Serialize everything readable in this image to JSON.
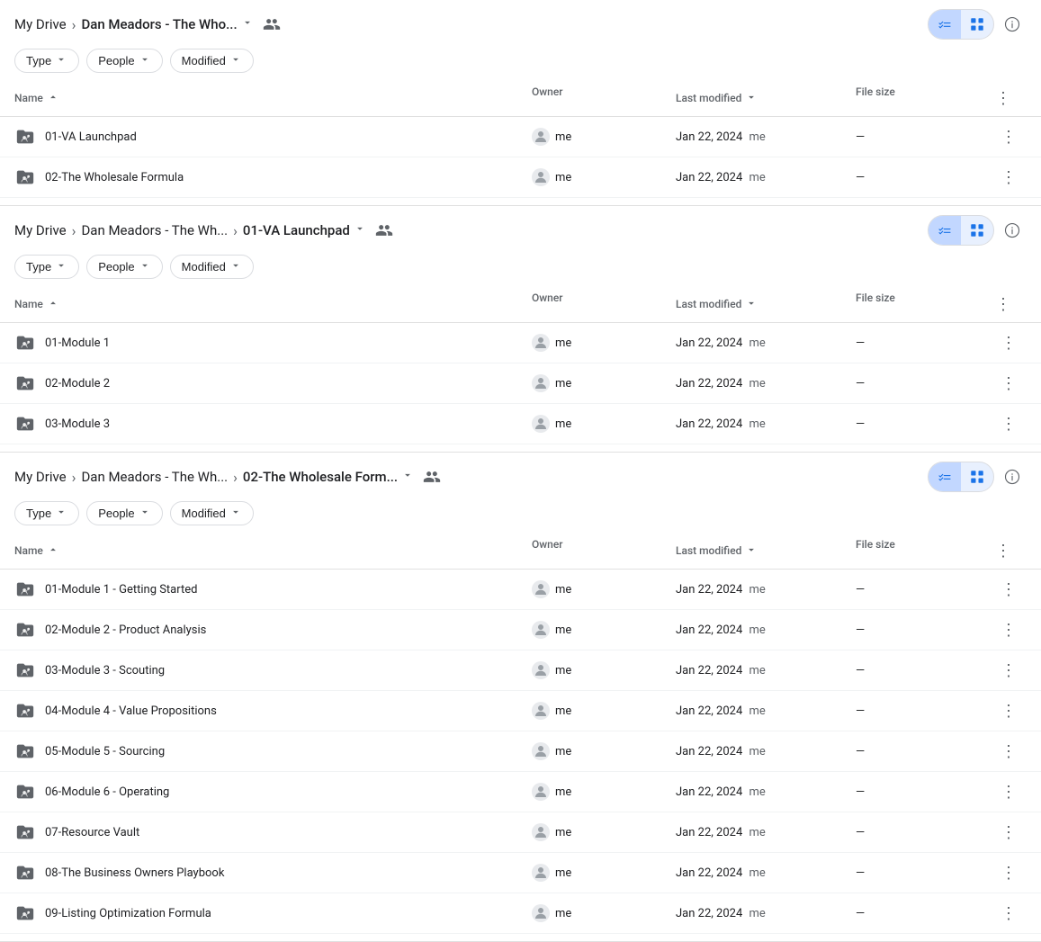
{
  "sections": [
    {
      "id": "section1",
      "breadcrumb": {
        "parts": [
          "My Drive",
          "Dan Meadors - The Who..."
        ],
        "current": null,
        "showCurrent": false
      },
      "filters": [
        "Type",
        "People",
        "Modified"
      ],
      "columns": [
        "Name",
        "Owner",
        "Last modified",
        "File size"
      ],
      "rows": [
        {
          "name": "01-VA Launchpad",
          "owner": "me",
          "modified": "Jan 22, 2024",
          "modifiedBy": "me",
          "fileSize": "—"
        },
        {
          "name": "02-The Wholesale Formula",
          "owner": "me",
          "modified": "Jan 22, 2024",
          "modifiedBy": "me",
          "fileSize": "—"
        }
      ]
    },
    {
      "id": "section2",
      "breadcrumb": {
        "parts": [
          "My Drive",
          "Dan Meadors - The Wh...",
          "01-VA Launchpad"
        ],
        "current": null,
        "showCurrent": false
      },
      "filters": [
        "Type",
        "People",
        "Modified"
      ],
      "columns": [
        "Name",
        "Owner",
        "Last modified",
        "File size"
      ],
      "rows": [
        {
          "name": "01-Module 1",
          "owner": "me",
          "modified": "Jan 22, 2024",
          "modifiedBy": "me",
          "fileSize": "—"
        },
        {
          "name": "02-Module 2",
          "owner": "me",
          "modified": "Jan 22, 2024",
          "modifiedBy": "me",
          "fileSize": "—"
        },
        {
          "name": "03-Module 3",
          "owner": "me",
          "modified": "Jan 22, 2024",
          "modifiedBy": "me",
          "fileSize": "—"
        }
      ]
    },
    {
      "id": "section3",
      "breadcrumb": {
        "parts": [
          "My Drive",
          "Dan Meadors - The Wh...",
          "02-The Wholesale Form..."
        ],
        "current": null,
        "showCurrent": false
      },
      "filters": [
        "Type",
        "People",
        "Modified"
      ],
      "columns": [
        "Name",
        "Owner",
        "Last modified",
        "File size"
      ],
      "rows": [
        {
          "name": "01-Module 1 - Getting Started",
          "owner": "me",
          "modified": "Jan 22, 2024",
          "modifiedBy": "me",
          "fileSize": "—"
        },
        {
          "name": "02-Module 2 - Product Analysis",
          "owner": "me",
          "modified": "Jan 22, 2024",
          "modifiedBy": "me",
          "fileSize": "—"
        },
        {
          "name": "03-Module 3 - Scouting",
          "owner": "me",
          "modified": "Jan 22, 2024",
          "modifiedBy": "me",
          "fileSize": "—"
        },
        {
          "name": "04-Module 4 - Value Propositions",
          "owner": "me",
          "modified": "Jan 22, 2024",
          "modifiedBy": "me",
          "fileSize": "—"
        },
        {
          "name": "05-Module 5 - Sourcing",
          "owner": "me",
          "modified": "Jan 22, 2024",
          "modifiedBy": "me",
          "fileSize": "—"
        },
        {
          "name": "06-Module 6 - Operating",
          "owner": "me",
          "modified": "Jan 22, 2024",
          "modifiedBy": "me",
          "fileSize": "—"
        },
        {
          "name": "07-Resource Vault",
          "owner": "me",
          "modified": "Jan 22, 2024",
          "modifiedBy": "me",
          "fileSize": "—"
        },
        {
          "name": "08-The Business Owners Playbook",
          "owner": "me",
          "modified": "Jan 22, 2024",
          "modifiedBy": "me",
          "fileSize": "—"
        },
        {
          "name": "09-Listing Optimization Formula",
          "owner": "me",
          "modified": "Jan 22, 2024",
          "modifiedBy": "me",
          "fileSize": "—"
        }
      ]
    }
  ],
  "labels": {
    "myDrive": "My Drive",
    "type": "Type",
    "people": "People",
    "modified": "Modified",
    "name": "Name",
    "owner": "Owner",
    "lastModified": "Last modified",
    "fileSize": "File size"
  }
}
